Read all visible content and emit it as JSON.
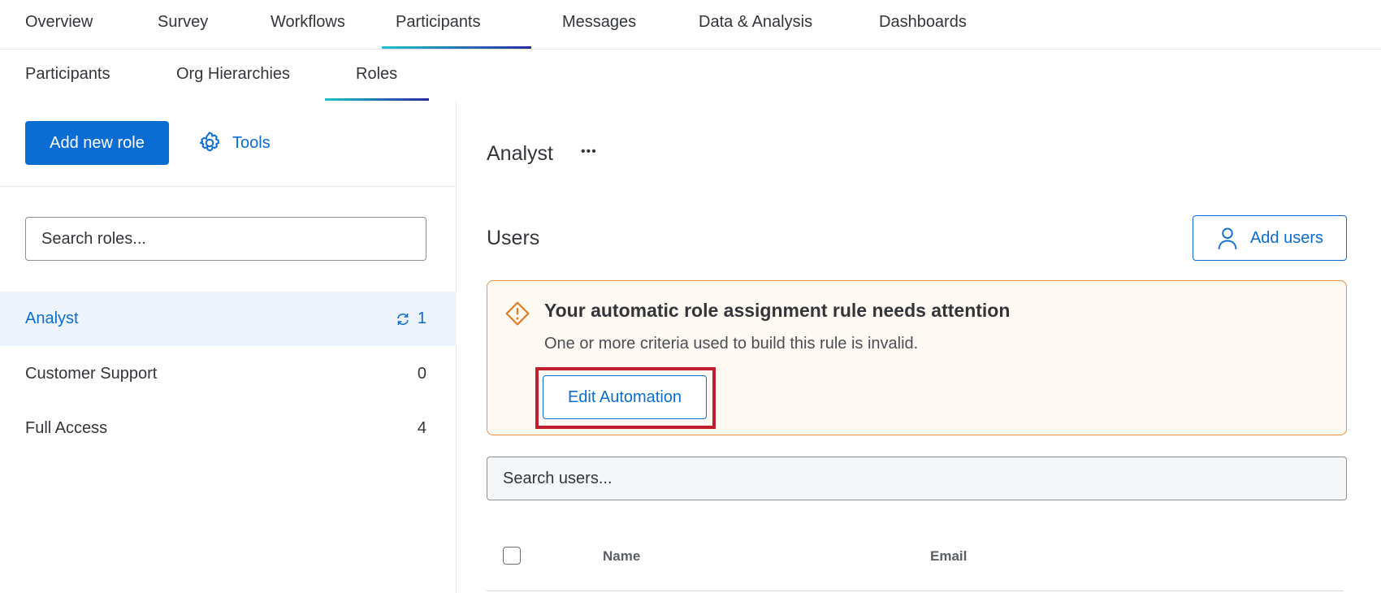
{
  "top_tabs": [
    "Overview",
    "Survey",
    "Workflows",
    "Participants",
    "Messages",
    "Data & Analysis",
    "Dashboards"
  ],
  "active_top_tab": "Participants",
  "sub_tabs": [
    "Participants",
    "Org Hierarchies",
    "Roles"
  ],
  "active_sub_tab": "Roles",
  "left": {
    "add_role": "Add new role",
    "tools": "Tools",
    "search_placeholder": "Search roles...",
    "roles": [
      {
        "name": "Analyst",
        "count": "1",
        "automated": true,
        "selected": true
      },
      {
        "name": "Customer Support",
        "count": "0"
      },
      {
        "name": "Full Access",
        "count": "4"
      }
    ]
  },
  "main": {
    "role_title": "Analyst",
    "more": "•••",
    "users_heading": "Users",
    "add_users": "Add users",
    "alert": {
      "title": "Your automatic role assignment rule needs attention",
      "message": "One or more criteria used to build this rule is invalid.",
      "button": "Edit Automation"
    },
    "search_users_placeholder": "Search users...",
    "columns": [
      "Name",
      "Email"
    ]
  },
  "colors": {
    "accent": "#0b6dd4",
    "warning": "#e7933b",
    "highlight": "#c0202e"
  }
}
